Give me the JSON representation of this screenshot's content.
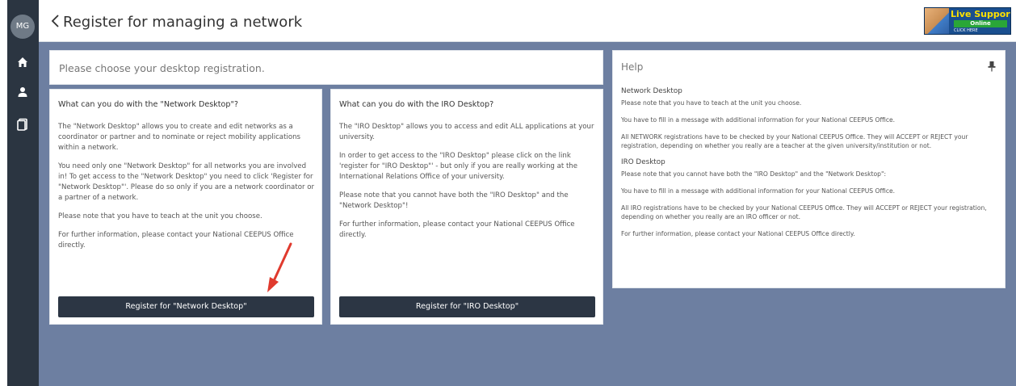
{
  "user": {
    "initials": "MG"
  },
  "header": {
    "title": "Register for managing a network"
  },
  "live_support": {
    "title": "Live Support!",
    "status": "Online",
    "click": "CLICK HERE"
  },
  "sidebar": {
    "icons": [
      "home-icon",
      "user-icon",
      "document-icon"
    ]
  },
  "choose_panel": {
    "title": "Please choose your desktop registration."
  },
  "network_card": {
    "heading": "What can you do with the \"Network Desktop\"?",
    "paragraphs": [
      "The \"Network Desktop\" allows you to create and edit networks as a coordinator or partner and to nominate or reject mobility applications within a network.",
      "You need only one \"Network Desktop\" for all networks you are involved in! To get access to the \"Network Desktop\" you need to click 'Register for \"Network Desktop\"'. Please do so only if you are a network coordinator or a partner of a network.",
      "Please note that you have to teach at the unit you choose.",
      "For further information, please contact your National CEEPUS Office directly."
    ],
    "button": "Register for \"Network Desktop\""
  },
  "iro_card": {
    "heading": "What can you do with the IRO Desktop?",
    "paragraphs": [
      "The \"IRO Desktop\" allows you to access and edit ALL applications at your university.",
      "In order to get access to the \"IRO Desktop\" please click on the link 'register for \"IRO Desktop\"' - but only if you are really working at the International Relations Office of your university.",
      "Please note that you cannot have both the \"IRO Desktop\" and the \"Network Desktop\"!",
      "For further information, please contact your National CEEPUS Office directly."
    ],
    "button": "Register for \"IRO Desktop\""
  },
  "help": {
    "title": "Help",
    "network_heading": "Network Desktop",
    "network_lines": [
      "Please note that you have to teach at the unit you choose.",
      "You have to fill in a message with additional information for your National CEEPUS Office.",
      "All NETWORK registrations have to be checked by your National CEEPUS Office. They will ACCEPT or REJECT your registration, depending on whether you really are a teacher at the given university/institution or not."
    ],
    "iro_heading": "IRO Desktop",
    "iro_lines": [
      "Please note that you cannot have both the \"IRO Desktop\" and the \"Network Desktop\":",
      "You have to fill in a message with additional information for your National CEEPUS Office.",
      "All IRO registrations have to be checked by your National CEEPUS Office. They will ACCEPT or REJECT your registration, depending on whether you really are an IRO officer or not.",
      "For further information, please contact your National CEEPUS Office directly."
    ]
  },
  "colors": {
    "sidebar": "#2b3541",
    "main_bg": "#6d7fa1",
    "button": "#2c3644",
    "arrow": "#e03a2e"
  }
}
